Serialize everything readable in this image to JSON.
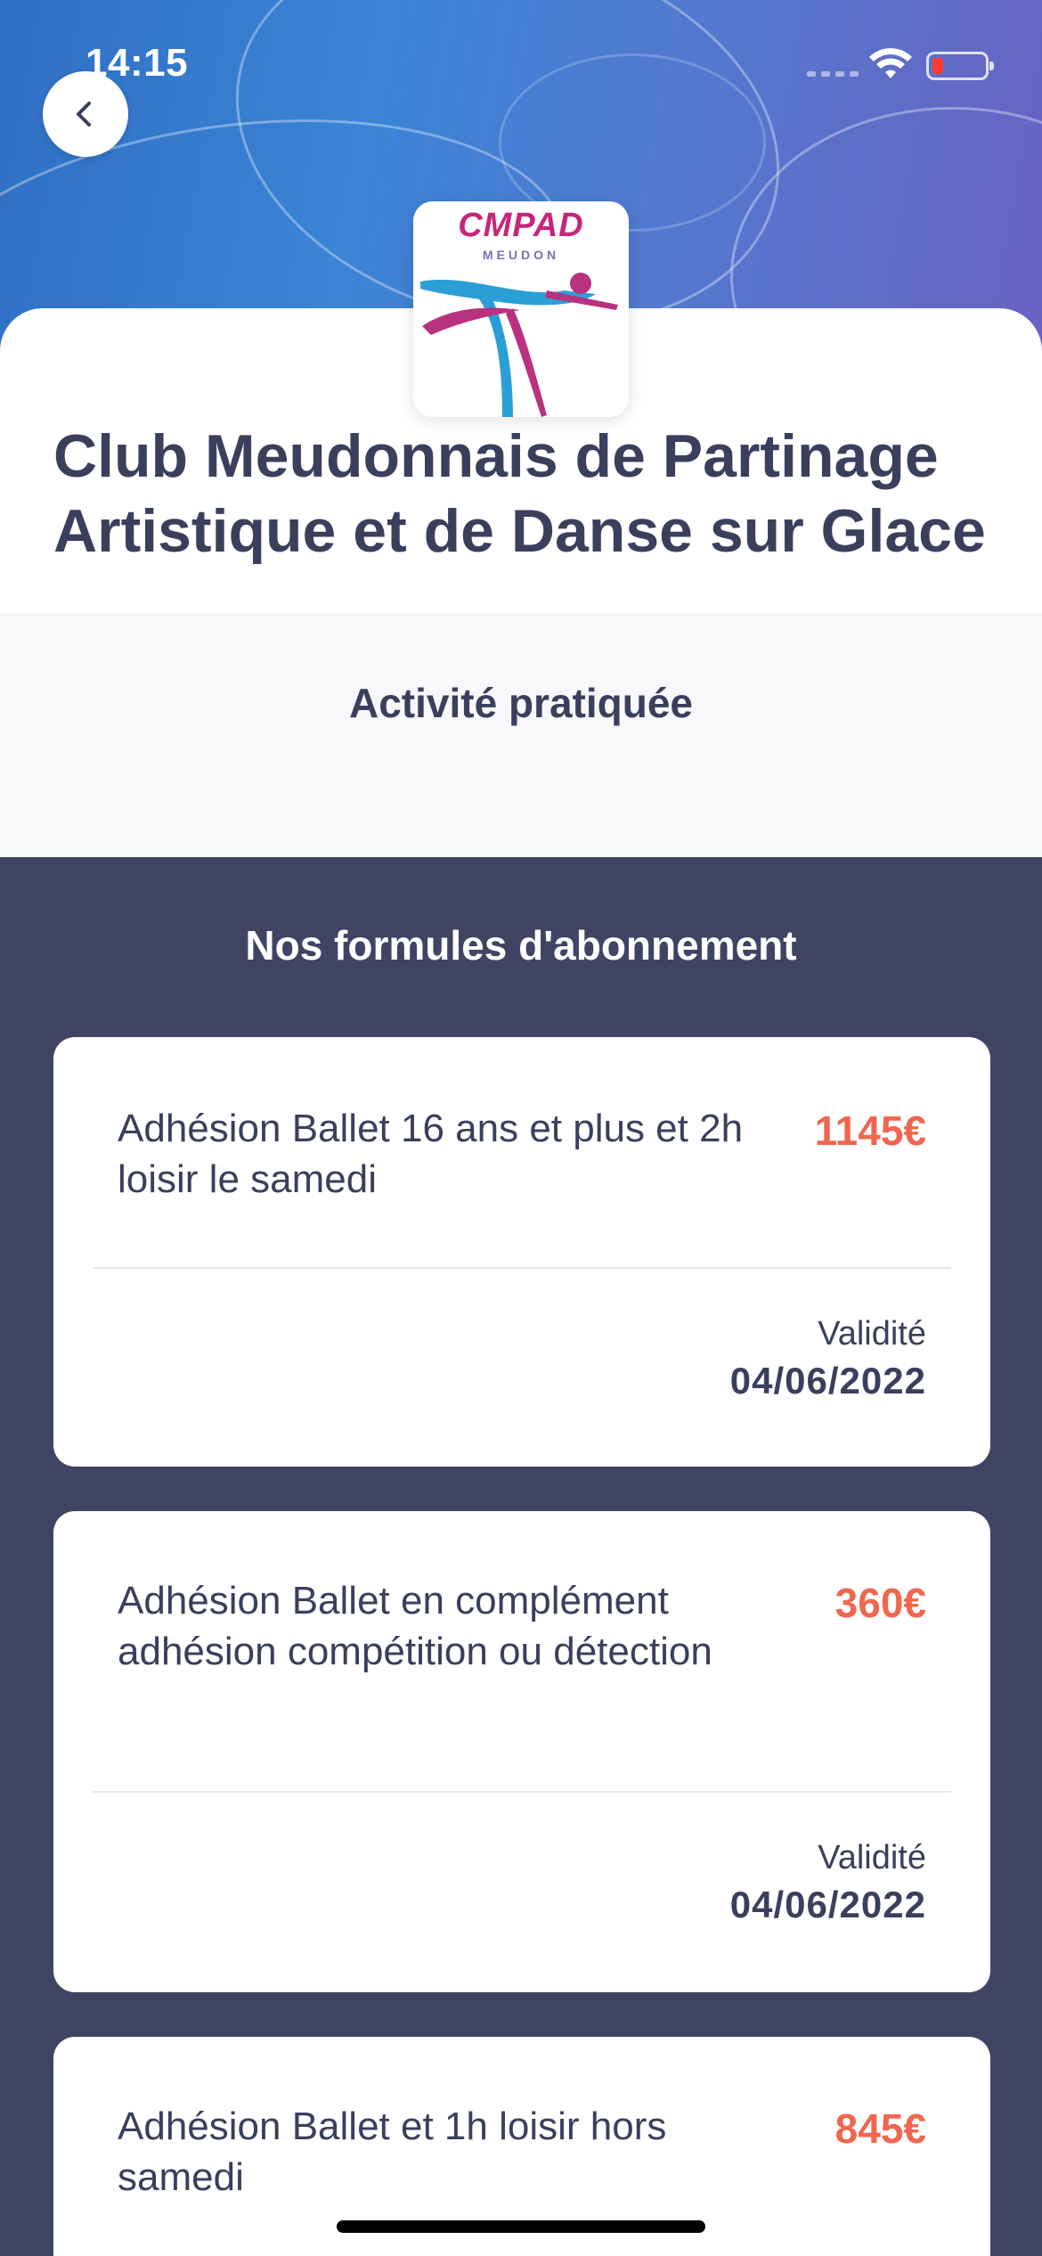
{
  "status_bar": {
    "time": "14:15"
  },
  "header": {
    "logo_text": "CMPAD",
    "logo_subtext": "MEUDON",
    "club_name": "Club Meudonnais de Partinage Artistique et de Danse sur Glace"
  },
  "activity": {
    "label": "Activité pratiquée"
  },
  "plans": {
    "heading": "Nos formules d'abonnement",
    "items": [
      {
        "name": "Adhésion Ballet 16 ans et plus et 2h loisir le samedi",
        "price": "1145€",
        "validity_label": "Validité",
        "validity_date": "04/06/2022"
      },
      {
        "name": "Adhésion Ballet en complément adhésion compétition ou détection",
        "price": "360€",
        "validity_label": "Validité",
        "validity_date": "04/06/2022"
      },
      {
        "name": "Adhésion Ballet et 1h loisir hors samedi",
        "price": "845€"
      }
    ]
  },
  "colors": {
    "primary_dark": "#3f4463",
    "price_accent": "#f0664f",
    "text_dark": "#3a3f5c"
  }
}
